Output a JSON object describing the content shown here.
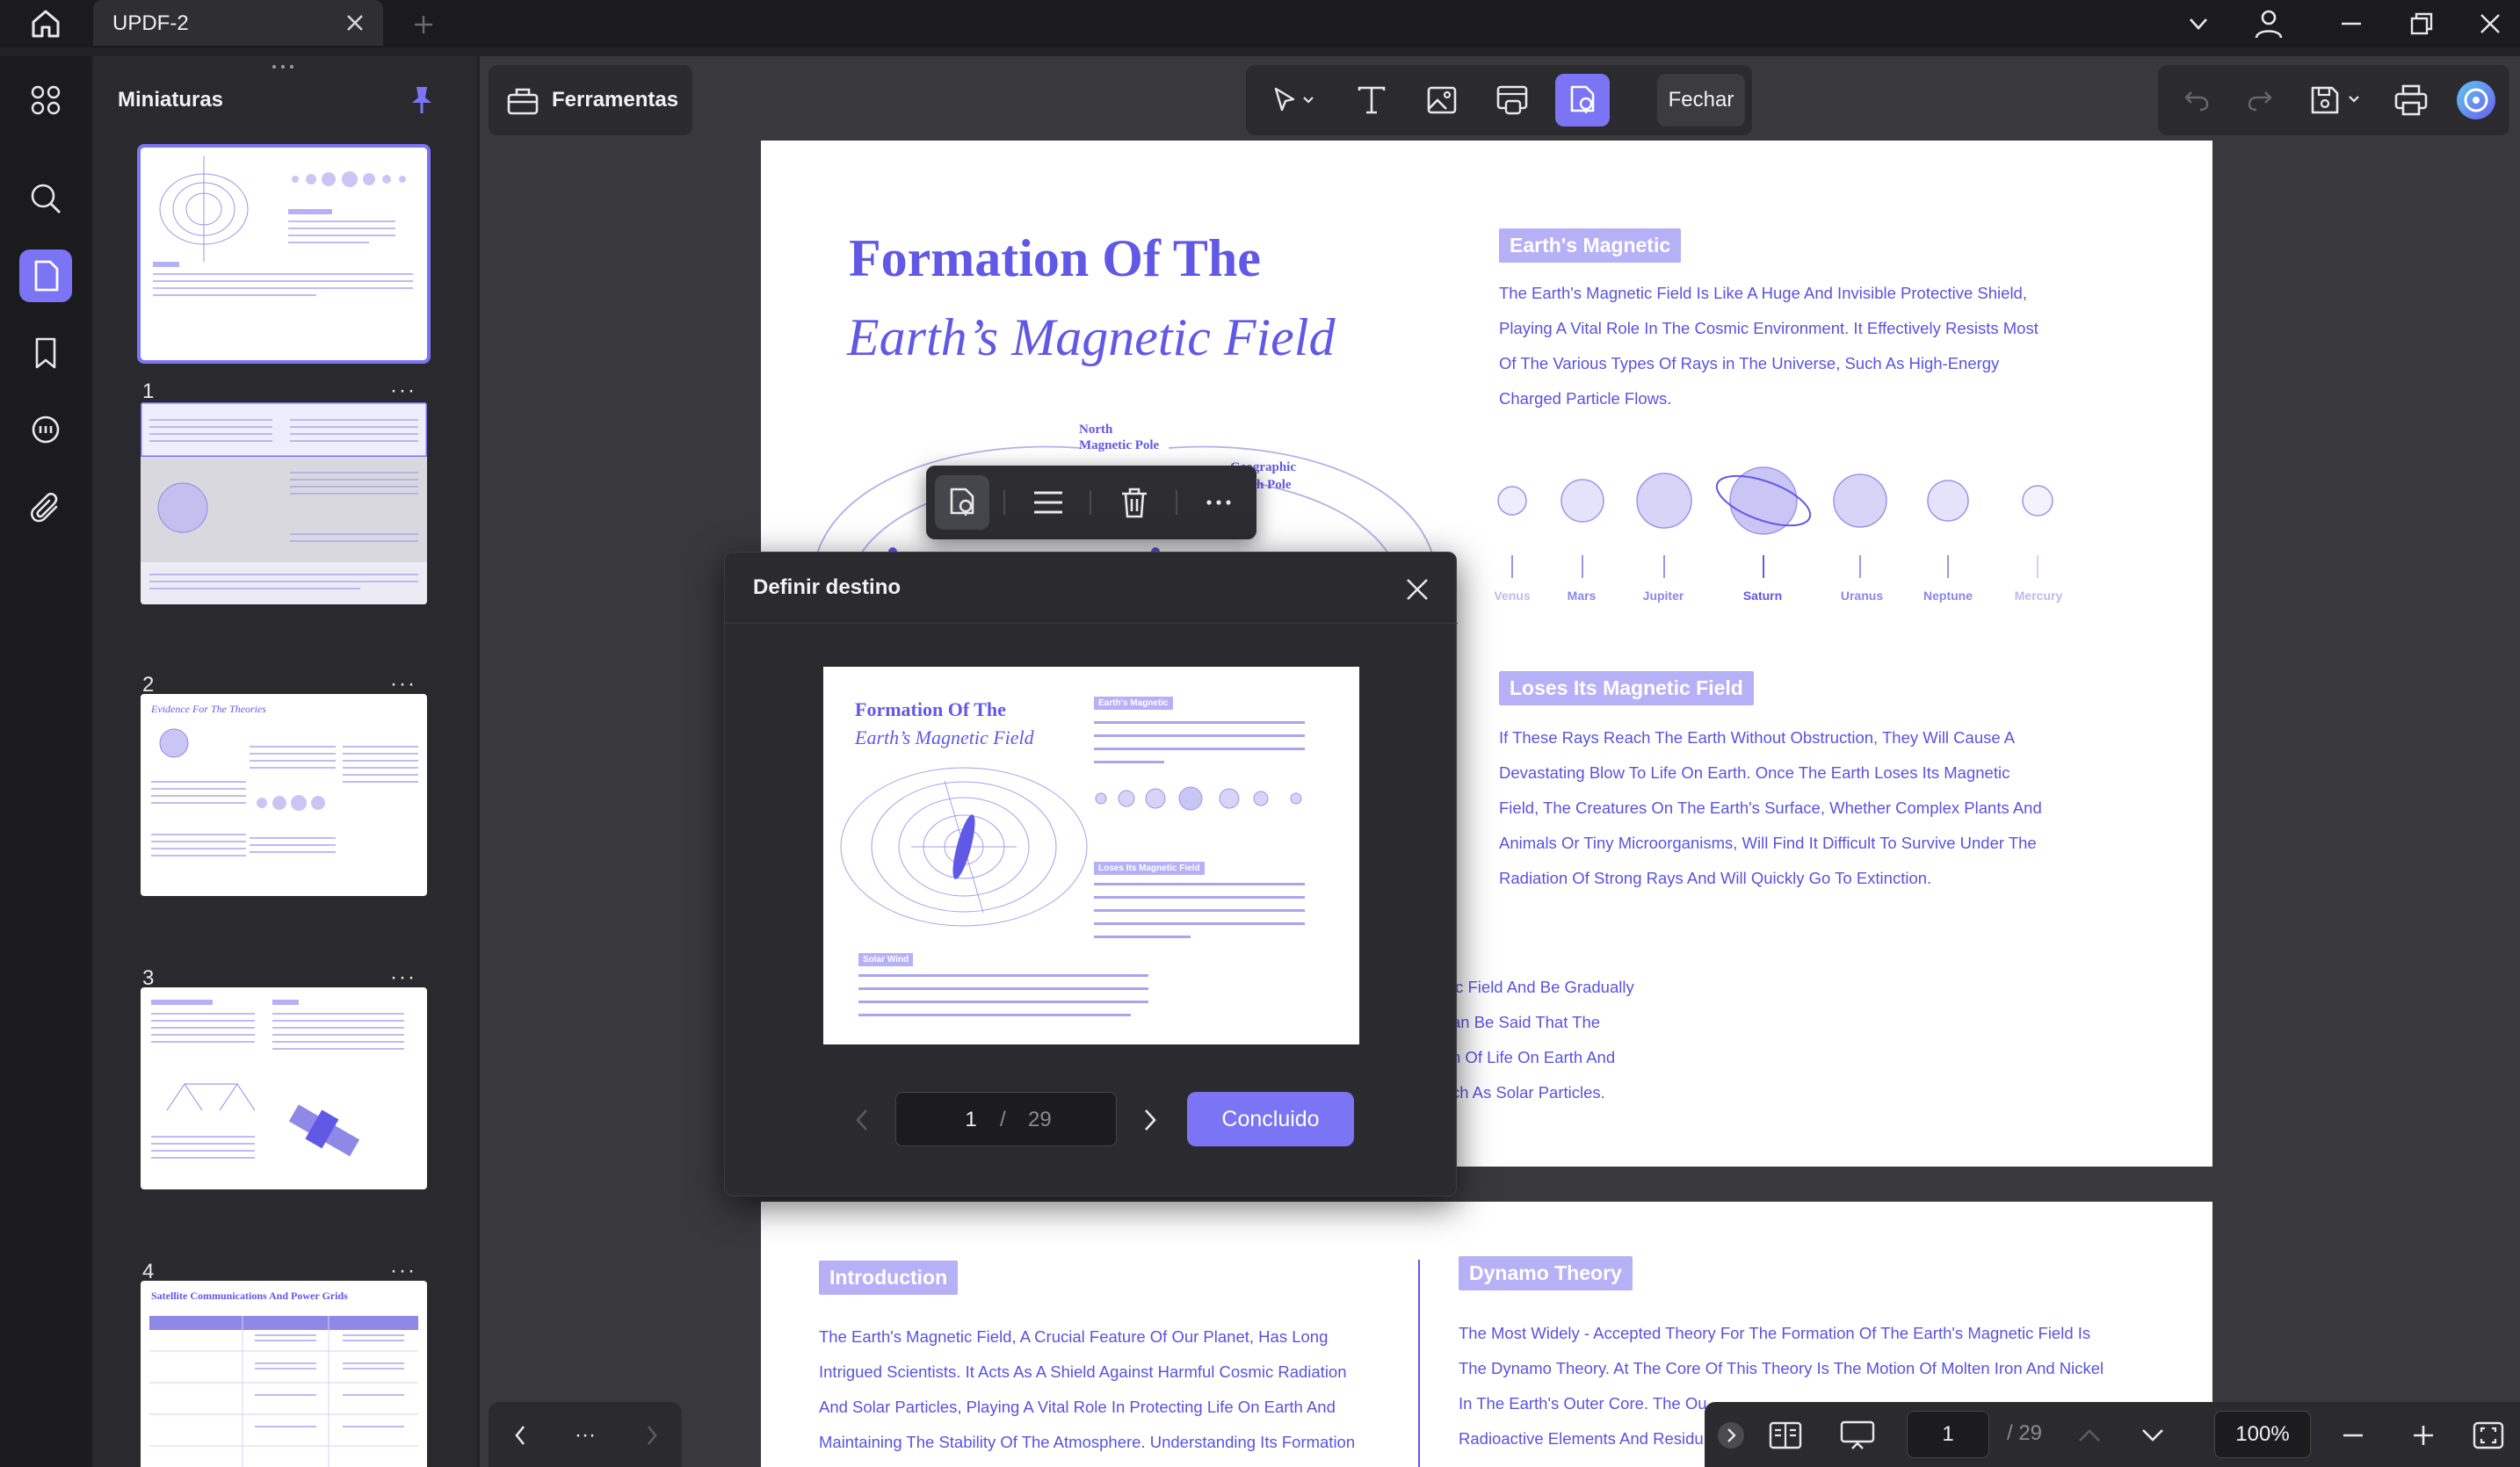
{
  "titlebar": {
    "tab_title": "UPDF-2"
  },
  "sidebar": {
    "title": "Miniaturas",
    "pages": [
      {
        "num": "1",
        "more": "···"
      },
      {
        "num": "2",
        "more": "···"
      },
      {
        "num": "3",
        "more": "···"
      },
      {
        "num": "4",
        "more": "···"
      }
    ],
    "thumb3_title": "Evidence For The Theories",
    "thumb5_title": "Satellite Communications And Power Grids"
  },
  "toolbar": {
    "tools_label": "Ferramentas",
    "close_label": "Fechar"
  },
  "page1": {
    "title_line1": "Formation Of The",
    "title_line2": "Earth’s Magnetic Field",
    "tag1": "Earth's Magnetic",
    "para1": [
      "The Earth's Magnetic Field Is Like A Huge And Invisible Protective Shield,",
      "Playing A Vital Role In The Cosmic Environment. It Effectively Resists Most",
      "Of The Various Types Of Rays in The Universe, Such As High-Energy",
      "Charged Particle Flows."
    ],
    "planets": [
      "Venus",
      "Mars",
      "Jupiter",
      "Saturn",
      "Uranus",
      "Neptune",
      "Mercury"
    ],
    "tag2": "Loses Its Magnetic Field",
    "para2": [
      "If These Rays Reach The Earth Without Obstruction, They Will Cause A",
      "Devastating Blow To Life On Earth. Once The Earth Loses Its Magnetic",
      "Field, The Creatures On The Earth's Surface, Whether Complex Plants And",
      "Animals Or Tiny Microorganisms, Will Find It Difficult To Survive Under The",
      "Radiation Of Strong Rays And Will Quickly Go To Extinction."
    ],
    "para3_fragments": [
      "ic Field And Be Gradually",
      "an Be Said That The",
      "n Of Life On Earth And",
      "ch As Solar Particles."
    ],
    "diagram_north_label": "North\nMagnetic Pole",
    "diagram_geo_label": "Geographic\nNorth Pole"
  },
  "page2": {
    "tag_left": "Introduction",
    "left_text": [
      "The Earth's Magnetic Field, A Crucial Feature Of Our Planet, Has Long",
      "Intrigued Scientists. It Acts As A Shield Against Harmful Cosmic Radiation",
      "And Solar Particles, Playing A Vital Role In Protecting Life On Earth And",
      "Maintaining The Stability Of The Atmosphere. Understanding Its Formation"
    ],
    "tag_right": "Dynamo Theory",
    "right_text": [
      "The Most Widely - Accepted Theory For The Formation Of The Earth's Magnetic Field Is",
      "The Dynamo Theory. At The Core Of This Theory Is The Motion Of Molten Iron And Nickel",
      "In The Earth's Outer Core. The Ou",
      "Radioactive Elements And Residu"
    ]
  },
  "dialog": {
    "title": "Definir destino",
    "current_page": "1",
    "slash": "/",
    "total_pages": "29",
    "done_label": "Concluido",
    "preview": {
      "title1": "Formation Of The",
      "title2": "Earth’s Magnetic Field",
      "tag1": "Earth's Magnetic",
      "tag2": "Loses Its Magnetic Field",
      "tag3": "Solar Wind"
    }
  },
  "bottom_nav": {
    "more": "···",
    "current_page": "1",
    "total": "/ 29",
    "zoom": "100%"
  },
  "colors": {
    "accent": "#7b74f5",
    "doc_text": "#5a52e0",
    "tag_bg": "#b6b0f7"
  }
}
